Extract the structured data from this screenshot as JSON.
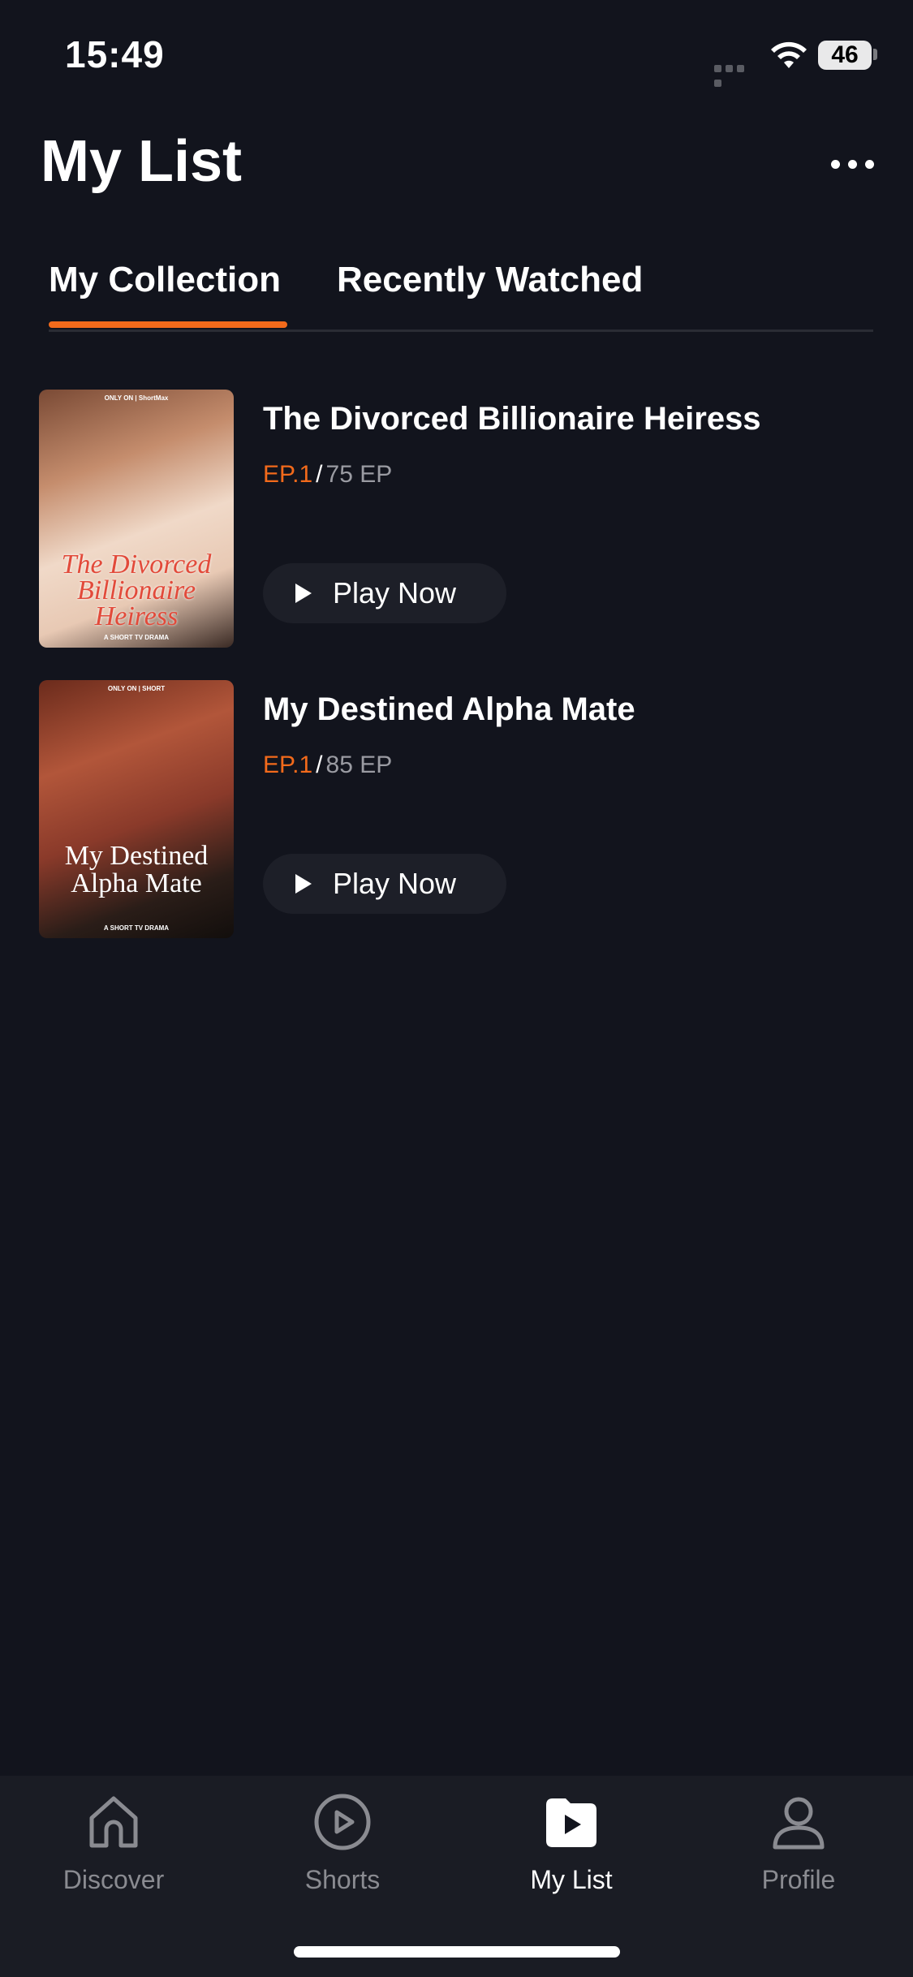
{
  "status_bar": {
    "time": "15:49",
    "battery": "46"
  },
  "header": {
    "title": "My List"
  },
  "tabs": [
    {
      "label": "My Collection",
      "active": true
    },
    {
      "label": "Recently Watched",
      "active": false
    }
  ],
  "items": [
    {
      "title": "The Divorced Billionaire Heiress",
      "episode_current": "EP.1",
      "separator": "/",
      "episode_total": "75 EP",
      "play_label": "Play Now",
      "poster": {
        "top_text": "ONLY ON | ShortMax",
        "title_text": "The Divorced Billionaire Heiress",
        "bottom_text": "A SHORT TV DRAMA"
      }
    },
    {
      "title": "My Destined Alpha Mate",
      "episode_current": "EP.1",
      "separator": "/",
      "episode_total": "85 EP",
      "play_label": "Play Now",
      "poster": {
        "top_text": "ONLY ON | SHORT",
        "title_text": "My Destined Alpha Mate",
        "bottom_text": "A SHORT TV DRAMA"
      }
    }
  ],
  "bottom_nav": [
    {
      "label": "Discover",
      "icon": "home-icon",
      "active": false
    },
    {
      "label": "Shorts",
      "icon": "play-circle-icon",
      "active": false
    },
    {
      "label": "My List",
      "icon": "folder-play-icon",
      "active": true
    },
    {
      "label": "Profile",
      "icon": "person-icon",
      "active": false
    }
  ],
  "colors": {
    "accent": "#f26a1b",
    "background": "#12141d",
    "nav_background": "#1a1c24"
  }
}
